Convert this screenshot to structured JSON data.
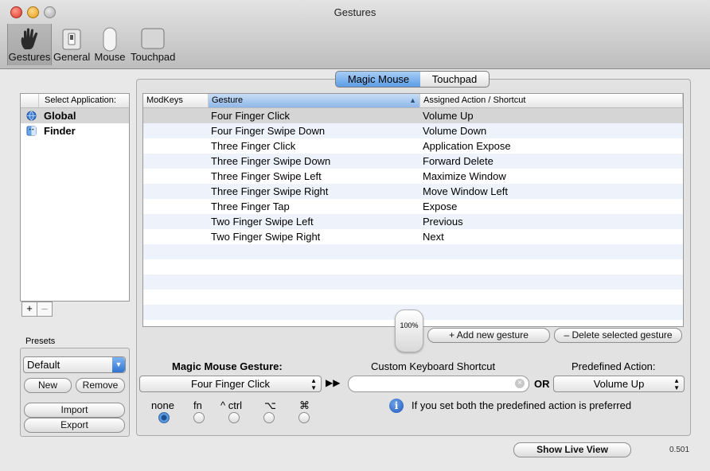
{
  "window": {
    "title": "Gestures",
    "version": "0.501"
  },
  "toolbar": {
    "items": [
      {
        "label": "Gestures",
        "icon": "hand-icon",
        "selected": true
      },
      {
        "label": "General",
        "icon": "switch-icon",
        "selected": false
      },
      {
        "label": "Mouse",
        "icon": "mouse-icon",
        "selected": false
      },
      {
        "label": "Touchpad",
        "icon": "touchpad-icon",
        "selected": false
      }
    ]
  },
  "apps": {
    "header": "Select Application:",
    "items": [
      {
        "name": "Global",
        "selected": true
      },
      {
        "name": "Finder",
        "selected": false
      }
    ],
    "add_label": "+",
    "remove_label": "–"
  },
  "presets": {
    "label": "Presets",
    "selected": "Default",
    "new_label": "New",
    "remove_label": "Remove",
    "import_label": "Import",
    "export_label": "Export"
  },
  "tabs": {
    "magic_mouse": "Magic Mouse",
    "touchpad": "Touchpad",
    "selected": "Magic Mouse"
  },
  "table": {
    "columns": [
      "ModKeys",
      "Gesture",
      "Assigned Action / Shortcut"
    ],
    "rows": [
      {
        "modkeys": "",
        "gesture": "Four Finger Click",
        "action": "Volume Up"
      },
      {
        "modkeys": "",
        "gesture": "Four Finger Swipe Down",
        "action": "Volume Down"
      },
      {
        "modkeys": "",
        "gesture": "Three Finger Click",
        "action": "Application Expose"
      },
      {
        "modkeys": "",
        "gesture": "Three Finger Swipe Down",
        "action": "Forward Delete"
      },
      {
        "modkeys": "",
        "gesture": "Three Finger Swipe Left",
        "action": "Maximize Window"
      },
      {
        "modkeys": "",
        "gesture": "Three Finger Swipe Right",
        "action": "Move Window Left"
      },
      {
        "modkeys": "",
        "gesture": "Three Finger Tap",
        "action": "Expose"
      },
      {
        "modkeys": "",
        "gesture": "Two Finger Swipe Left",
        "action": "Previous"
      },
      {
        "modkeys": "",
        "gesture": "Two Finger Swipe Right",
        "action": "Next"
      }
    ]
  },
  "mouse_zoom": "100%",
  "buttons": {
    "add_gesture": "+ Add new gesture",
    "delete_gesture": "– Delete selected gesture",
    "show_live_view": "Show Live View"
  },
  "editor": {
    "gesture_label": "Magic Mouse Gesture:",
    "gesture_value": "Four Finger Click",
    "shortcut_label": "Custom Keyboard Shortcut",
    "shortcut_value": "",
    "or_label": "OR",
    "action_label": "Predefined Action:",
    "action_value": "Volume Up",
    "arrows": "▶▶",
    "modifiers": [
      {
        "label": "none",
        "checked": true
      },
      {
        "label": "fn",
        "checked": false
      },
      {
        "label": "^ ctrl",
        "checked": false
      },
      {
        "label": "⌥",
        "checked": false
      },
      {
        "label": "⌘",
        "checked": false
      }
    ],
    "info_text": "If you set both the predefined action is preferred"
  }
}
